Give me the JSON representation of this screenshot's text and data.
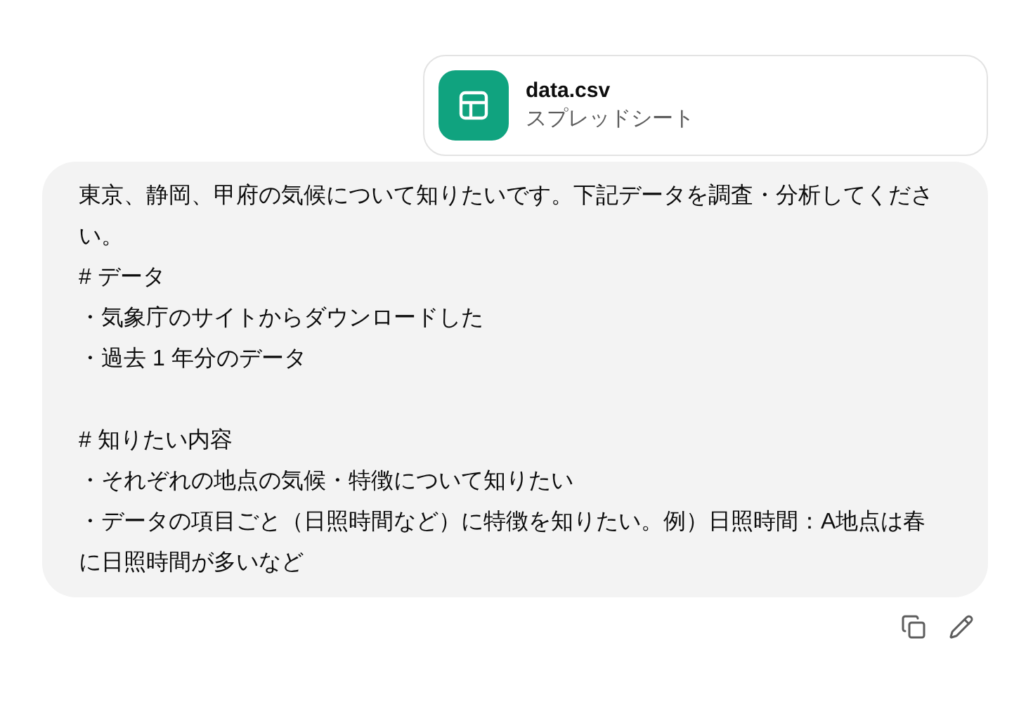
{
  "attachment": {
    "name": "data.csv",
    "type": "スプレッドシート"
  },
  "message": {
    "blocks": [
      {
        "lines": [
          "東京、静岡、甲府の気候について知りたいです。下記データを調査・分析してください。",
          "# データ",
          "・気象庁のサイトからダウンロードした",
          "・過去 1 年分のデータ"
        ]
      },
      {
        "lines": [
          "# 知りたい内容",
          "・それぞれの地点の気候・特徴について知りたい",
          "・データの項目ごと（日照時間など）に特徴を知りたい。例）日照時間：A地点は春に日照時間が多いなど"
        ]
      }
    ]
  }
}
